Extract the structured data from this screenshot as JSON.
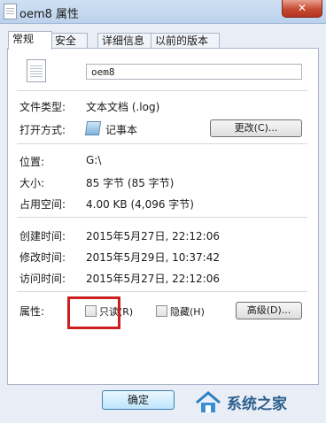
{
  "window": {
    "title": "oem8 属性",
    "close_label": "✕"
  },
  "tabs": [
    {
      "label": "常规",
      "active": true
    },
    {
      "label": "安全",
      "active": false
    },
    {
      "label": "详细信息",
      "active": false
    },
    {
      "label": "以前的版本",
      "active": false
    }
  ],
  "general": {
    "filename": "oem8",
    "file_type_label": "文件类型:",
    "file_type_value": "文本文档 (.log)",
    "opens_with_label": "打开方式:",
    "opens_with_value": "记事本",
    "change_button": "更改(C)...",
    "location_label": "位置:",
    "location_value": "G:\\",
    "size_label": "大小:",
    "size_value": "85 字节 (85 字节)",
    "size_on_disk_label": "占用空间:",
    "size_on_disk_value": "4.00 KB (4,096 字节)",
    "created_label": "创建时间:",
    "created_value": "2015年5月27日, 22:12:06",
    "modified_label": "修改时间:",
    "modified_value": "2015年5月29日, 10:37:42",
    "accessed_label": "访问时间:",
    "accessed_value": "2015年5月27日, 22:12:06",
    "attributes_label": "属性:",
    "readonly_label": "只读(R)",
    "readonly_checked": false,
    "hidden_label": "隐藏(H)",
    "hidden_checked": false,
    "advanced_button": "高级(D)..."
  },
  "footer": {
    "ok_button": "确定"
  },
  "watermark": {
    "text": "系统之家"
  },
  "colors": {
    "highlight": "#cc1f1f",
    "close_button": "#c54a33"
  }
}
